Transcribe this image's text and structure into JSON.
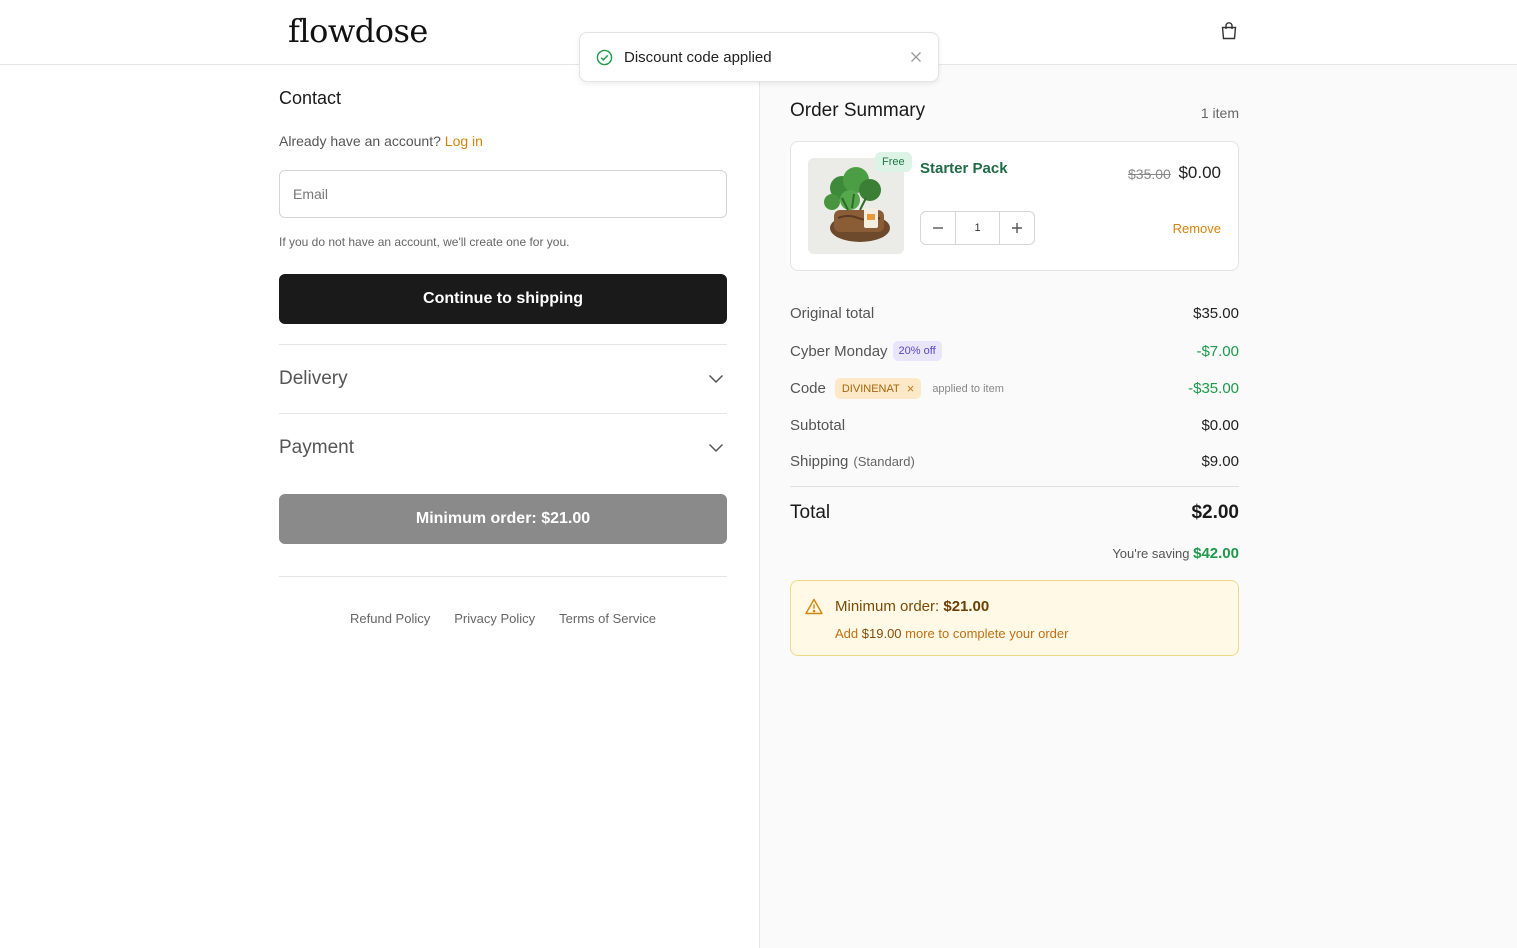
{
  "brand": {
    "logo_text": "flowdose"
  },
  "toast": {
    "message": "Discount code applied"
  },
  "contact": {
    "title": "Contact",
    "account_prompt": "Already have an account?",
    "login_label": "Log in",
    "email_placeholder": "Email",
    "hint": "If you do not have an account, we'll create one for you.",
    "continue_label": "Continue to shipping"
  },
  "sections": {
    "delivery_label": "Delivery",
    "payment_label": "Payment"
  },
  "min_order_button": "Minimum order: $21.00",
  "footer": {
    "refund": "Refund Policy",
    "privacy": "Privacy Policy",
    "terms": "Terms of Service"
  },
  "summary": {
    "title": "Order Summary",
    "count": "1 item",
    "item": {
      "badge": "Free",
      "name": "Starter Pack",
      "old_price": "$35.00",
      "price": "$0.00",
      "qty": "1",
      "remove_label": "Remove"
    },
    "rows": {
      "original_label": "Original total",
      "original_val": "$35.00",
      "cyber_label": "Cyber Monday",
      "cyber_tag": "20% off",
      "cyber_val": "-$7.00",
      "code_label": "Code",
      "code_tag": "DIVINENAT",
      "code_note": "applied to item",
      "code_val": "-$35.00",
      "subtotal_label": "Subtotal",
      "subtotal_val": "$0.00",
      "shipping_label": "Shipping",
      "shipping_method": "(Standard)",
      "shipping_val": "$9.00"
    },
    "total_label": "Total",
    "total_val": "$2.00",
    "saving_label": "You're saving",
    "saving_val": "$42.00",
    "warning": {
      "title_prefix": "Minimum order:",
      "title_amount": "$21.00",
      "sub_prefix": "Add",
      "sub_amount": "$19.00",
      "sub_suffix": "more to complete your order"
    }
  },
  "colors": {
    "accent_orange": "#d6830b",
    "success_green": "#1d9a4a",
    "button_dark": "#1a1a1a",
    "button_disabled": "#8a8a8a"
  }
}
